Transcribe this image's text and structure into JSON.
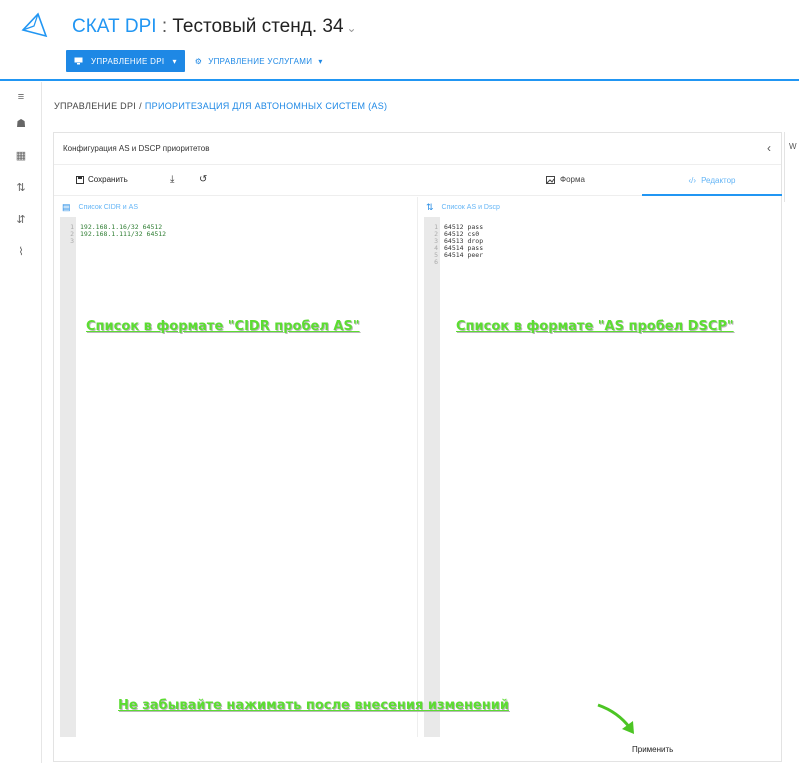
{
  "header": {
    "brand": "СКАТ DPI",
    "separator": " : ",
    "stand": "Тестовый стенд. 34",
    "stand_caret": "⌄",
    "nav": {
      "dpi_label": "УПРАВЛЕНИЕ DPI",
      "services_label": "УПРАВЛЕНИЕ УСЛУГАМИ"
    }
  },
  "rail": {
    "items": [
      {
        "icon": "menu-icon",
        "glyph": "≡"
      },
      {
        "icon": "dashboard-icon",
        "glyph": "☗"
      },
      {
        "icon": "table-icon",
        "glyph": "▦"
      },
      {
        "icon": "sort-icon",
        "glyph": "⇅"
      },
      {
        "icon": "sort-numeric-icon",
        "glyph": "⇵"
      },
      {
        "icon": "chart-icon",
        "glyph": "⌇"
      }
    ]
  },
  "breadcrumb": {
    "root": "УПРАВЛЕНИЕ DPI",
    "current": "ПРИОРИТЕЗАЦИЯ ДЛЯ АВТОНОМНЫХ СИСТЕМ (AS)"
  },
  "card": {
    "title": "Конфигурация AS и DSCP приоритетов",
    "collapse_glyph": "‹",
    "toolbar": {
      "save_label": "Сохранить",
      "tab_form": "Форма",
      "tab_editor": "Редактор"
    }
  },
  "left_pane": {
    "title": "Список CIDR и AS",
    "line_numbers": [
      "1",
      "2",
      "3"
    ],
    "lines": [
      "192.168.1.16/32 64512",
      "192.168.1.111/32 64512",
      ""
    ]
  },
  "right_pane": {
    "title": "Список AS и Dscp",
    "line_numbers": [
      "1",
      "2",
      "3",
      "4",
      "5",
      "6"
    ],
    "lines": [
      "64512 pass",
      "64512 cs0",
      "64513 drop",
      "64514 pass",
      "64514 peer",
      ""
    ]
  },
  "annotations": {
    "left": "Список в формате \"CIDR пробел AS\"",
    "right": "Список в формате \"AS пробел DSCP\"",
    "bottom": "Не забывайте нажимать после внесения изменений"
  },
  "footer": {
    "apply_label": "Применить"
  },
  "right_edge": {
    "label": "W"
  },
  "colors": {
    "accent": "#2196f3",
    "annotation": "#5cdc32"
  }
}
